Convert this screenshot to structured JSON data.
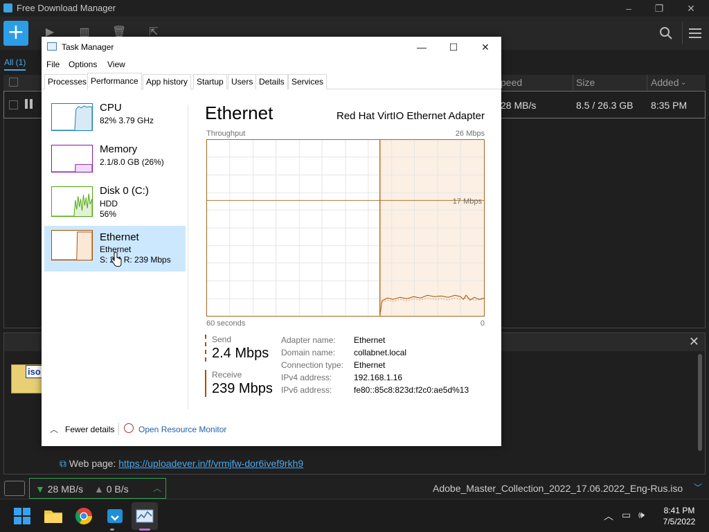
{
  "fdm": {
    "window_title": "Free Download Manager",
    "tab_all": "All (1)",
    "columns": {
      "speed": "peed",
      "size": "Size",
      "added": "Added"
    },
    "download": {
      "speed": "28 MB/s",
      "size": "8.5 / 26.3 GB",
      "added": "8:35 PM"
    },
    "iso_label": "iso",
    "web_page_label": "Web page:",
    "web_page_url": "https://uploadever.in/f/vrmjfw-dor6ivef9rkh9",
    "status": {
      "download_speed": "28 MB/s",
      "upload_speed": "0 B/s",
      "filename": "Adobe_Master_Collection_2022_17.06.2022_Eng-Rus.iso"
    }
  },
  "taskmgr": {
    "title": "Task Manager",
    "menu": [
      "File",
      "Options",
      "View"
    ],
    "tabs": [
      "Processes",
      "Performance",
      "App history",
      "Startup",
      "Users",
      "Details",
      "Services"
    ],
    "active_tab": "Performance",
    "sidebar": [
      {
        "name": "CPU",
        "line1": "82%  3.79 GHz",
        "line2": "",
        "color": "#117dbb"
      },
      {
        "name": "Memory",
        "line1": "2.1/8.0 GB (26%)",
        "line2": "",
        "color": "#8b12ae"
      },
      {
        "name": "Disk 0 (C:)",
        "line1": "HDD",
        "line2": "56%",
        "color": "#4da60c"
      },
      {
        "name": "Ethernet",
        "line1": "Ethernet",
        "line2": "S: 2.4  R: 239 Mbps",
        "color": "#a74f01"
      }
    ],
    "main": {
      "heading": "Ethernet",
      "adapter": "Red Hat VirtIO Ethernet Adapter",
      "graph_label": "Throughput",
      "graph_max": "26 Mbps",
      "graph_mid": "17 Mbps",
      "graph_time": "60 seconds",
      "graph_zero": "0",
      "send_label": "Send",
      "send_value": "2.4 Mbps",
      "receive_label": "Receive",
      "receive_value": "239 Mbps",
      "details": [
        {
          "key": "Adapter name:",
          "value": "Ethernet"
        },
        {
          "key": "Domain name:",
          "value": "collabnet.local"
        },
        {
          "key": "Connection type:",
          "value": "Ethernet"
        },
        {
          "key": "IPv4 address:",
          "value": "192.168.1.16"
        },
        {
          "key": "IPv6 address:",
          "value": "fe80::85c8:823d:f2c0:ae5d%13"
        }
      ]
    },
    "footer": {
      "fewer_details": "Fewer details",
      "open_resource_monitor": "Open Resource Monitor"
    }
  },
  "taskbar": {
    "time": "8:41 PM",
    "date": "7/5/2022"
  },
  "colors": {
    "accent": "#2c9ee8",
    "ethernet": "#a74f01",
    "selected": "#cce8ff",
    "speed_border": "#2ea44f"
  }
}
